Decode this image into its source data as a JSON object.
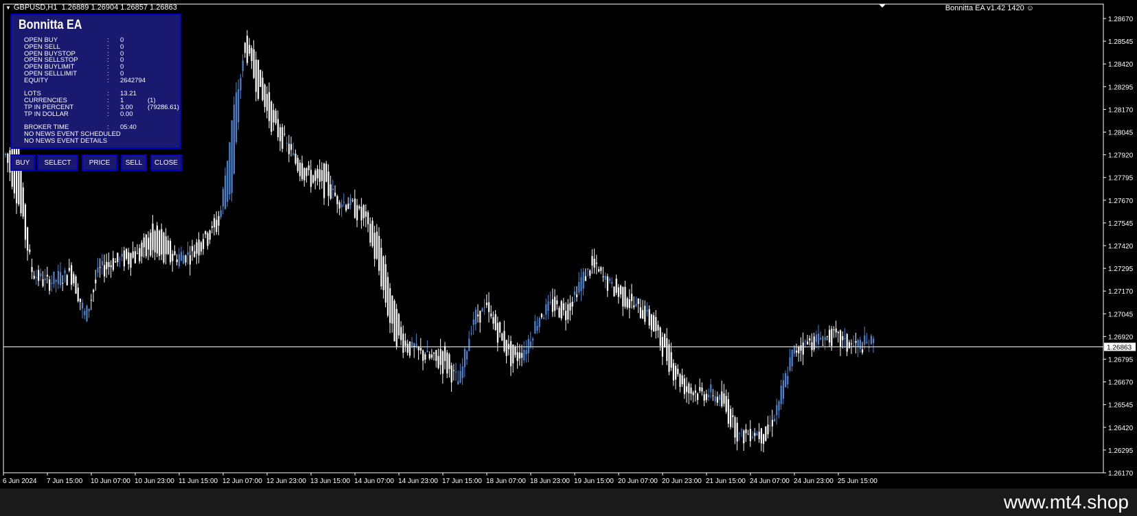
{
  "header": {
    "symbol": "GBPUSD,H1",
    "quotes": "1.26889 1.26904 1.26857 1.26863",
    "ea_label": "Bonnitta EA  v1.42 1420"
  },
  "panel": {
    "title": "Bonnitta EA",
    "rows": [
      {
        "label": "OPEN BUY",
        "value": "0",
        "extra": ""
      },
      {
        "label": "OPEN SELL",
        "value": "0",
        "extra": ""
      },
      {
        "label": "OPEN BUYSTOP",
        "value": "0",
        "extra": ""
      },
      {
        "label": "OPEN SELLSTOP",
        "value": "0",
        "extra": ""
      },
      {
        "label": "OPEN BUYLIMIT",
        "value": "0",
        "extra": ""
      },
      {
        "label": "OPEN SELLLIMIT",
        "value": "0",
        "extra": ""
      },
      {
        "label": "EQUITY",
        "value": "2642794",
        "extra": ""
      },
      {
        "label": "LOTS",
        "value": "13.21",
        "extra": ""
      },
      {
        "label": "CURRENCIES",
        "value": "1",
        "extra": "(1)"
      },
      {
        "label": "TP IN PERCENT",
        "value": "3.00",
        "extra": "(79286.61)"
      },
      {
        "label": "TP IN DOLLAR",
        "value": "0.00",
        "extra": ""
      },
      {
        "label": "BROKER TIME",
        "value": "05:40",
        "extra": ""
      },
      {
        "label": "NO NEWS EVENT SCHEDULED",
        "value": "",
        "extra": ""
      },
      {
        "label": "NO NEWS EVENT DETAILS",
        "value": "",
        "extra": ""
      }
    ],
    "separator": ":"
  },
  "buttons": {
    "buy": "BUY",
    "select": "SELECT",
    "price": "PRICE",
    "sell": "SELL",
    "close": "CLOSE"
  },
  "footer": {
    "watermark": "www.mt4.shop"
  },
  "colors": {
    "background": "#000000",
    "bull": "#4a86d8",
    "bear": "#ffffff",
    "panel": "#191970",
    "panel_border": "#0000cd"
  },
  "chart_data": {
    "type": "candlestick",
    "symbol": "GBPUSD",
    "timeframe": "H1",
    "current_price": "1.26863",
    "y_ticks": [
      "1.28670",
      "1.28545",
      "1.28420",
      "1.28295",
      "1.28170",
      "1.28045",
      "1.27920",
      "1.27795",
      "1.27670",
      "1.27545",
      "1.27420",
      "1.27295",
      "1.27170",
      "1.27045",
      "1.26920",
      "1.26795",
      "1.26670",
      "1.26545",
      "1.26420",
      "1.26295",
      "1.26170"
    ],
    "x_ticks": [
      "6 Jun 2024",
      "7 Jun 15:00",
      "10 Jun 07:00",
      "10 Jun 23:00",
      "11 Jun 15:00",
      "12 Jun 07:00",
      "12 Jun 23:00",
      "13 Jun 15:00",
      "14 Jun 07:00",
      "14 Jun 23:00",
      "17 Jun 15:00",
      "18 Jun 07:00",
      "18 Jun 23:00",
      "19 Jun 15:00",
      "20 Jun 07:00",
      "20 Jun 23:00",
      "21 Jun 15:00",
      "24 Jun 07:00",
      "24 Jun 23:00",
      "25 Jun 15:00"
    ],
    "ylim": [
      1.2617,
      1.2867
    ],
    "path_points": [
      [
        1.2792,
        1.2792
      ],
      [
        1.2798,
        1.2732
      ],
      [
        1.2728,
        1.2727
      ],
      [
        1.2724,
        1.2718
      ],
      [
        1.2721,
        1.2728
      ],
      [
        1.2732,
        1.2718
      ],
      [
        1.27,
        1.2706
      ],
      [
        1.273,
        1.2725
      ],
      [
        1.2734,
        1.273
      ],
      [
        1.2738,
        1.273
      ],
      [
        1.274,
        1.2731
      ],
      [
        1.2752,
        1.2725
      ],
      [
        1.2748,
        1.2718
      ],
      [
        1.2732,
        1.2742
      ],
      [
        1.274,
        1.2733
      ],
      [
        1.275,
        1.2738
      ],
      [
        1.2758,
        1.275
      ],
      [
        1.2772,
        1.2855
      ],
      [
        1.286,
        1.2838
      ],
      [
        1.2842,
        1.281
      ],
      [
        1.2818,
        1.2798
      ],
      [
        1.28,
        1.2795
      ],
      [
        1.279,
        1.2778
      ],
      [
        1.2782,
        1.2772
      ],
      [
        1.2785,
        1.276
      ],
      [
        1.2765,
        1.277
      ],
      [
        1.2766,
        1.276
      ],
      [
        1.2762,
        1.2745
      ],
      [
        1.2745,
        1.271
      ],
      [
        1.2712,
        1.2675
      ],
      [
        1.269,
        1.2682
      ],
      [
        1.2685,
        1.268
      ],
      [
        1.2682,
        1.2675
      ],
      [
        1.2685,
        1.2665
      ],
      [
        1.2665,
        1.2668
      ],
      [
        1.2695,
        1.271
      ],
      [
        1.2712,
        1.27
      ],
      [
        1.2698,
        1.2685
      ],
      [
        1.2685,
        1.267
      ],
      [
        1.268,
        1.2695
      ],
      [
        1.27,
        1.2708
      ],
      [
        1.2712,
        1.2705
      ],
      [
        1.2708,
        1.27
      ],
      [
        1.2715,
        1.273
      ],
      [
        1.2735,
        1.2725
      ],
      [
        1.2725,
        1.2718
      ],
      [
        1.272,
        1.2708
      ],
      [
        1.2712,
        1.2705
      ],
      [
        1.2708,
        1.2698
      ],
      [
        1.2698,
        1.268
      ],
      [
        1.268,
        1.2665
      ],
      [
        1.2665,
        1.266
      ],
      [
        1.2662,
        1.2658
      ],
      [
        1.2658,
        1.2665
      ],
      [
        1.266,
        1.264
      ],
      [
        1.264,
        1.2632
      ],
      [
        1.2638,
        1.2642
      ],
      [
        1.264,
        1.2632
      ],
      [
        1.265,
        1.2668
      ],
      [
        1.268,
        1.2688
      ],
      [
        1.2692,
        1.2682
      ],
      [
        1.2688,
        1.2695
      ],
      [
        1.2695,
        1.2688
      ],
      [
        1.2692,
        1.268
      ],
      [
        1.2685,
        1.269
      ],
      [
        1.269,
        1.2686
      ]
    ]
  }
}
